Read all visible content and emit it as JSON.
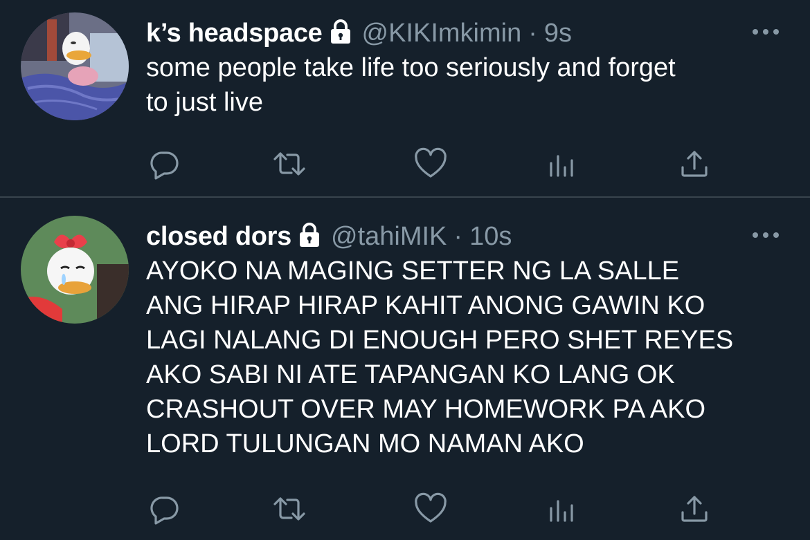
{
  "tweets": [
    {
      "display_name": "k’s headspace",
      "handle": "@KIKImkimin",
      "separator": "·",
      "time": "9s",
      "text_lines": [
        "some people take life too seriously and forget",
        "to just live"
      ],
      "protected": true,
      "avatar": "donald-duck-in-bed-avatar"
    },
    {
      "display_name": "closed dors",
      "handle": "@tahiMIK",
      "separator": "·",
      "time": "10s",
      "text_lines": [
        "AYOKO NA MAGING SETTER NG LA SALLE",
        "ANG HIRAP HIRAP KAHIT ANONG GAWIN KO",
        "LAGI NALANG DI ENOUGH PERO SHET REYES",
        "AKO SABI NI ATE TAPANGAN KO LANG OK",
        "CRASHOUT OVER MAY HOMEWORK PA AKO",
        "LORD TULUNGAN MO NAMAN AKO"
      ],
      "protected": true,
      "avatar": "daisy-duck-crying-avatar"
    }
  ],
  "actions": [
    "reply-icon",
    "retweet-icon",
    "like-icon",
    "analytics-icon",
    "share-icon"
  ],
  "icons": {
    "lock": "lock-icon",
    "more": "more-icon"
  },
  "colors": {
    "background": "#15202b",
    "primary_text": "#ffffff",
    "secondary_text": "#8899a6",
    "divider": "#38444d"
  }
}
